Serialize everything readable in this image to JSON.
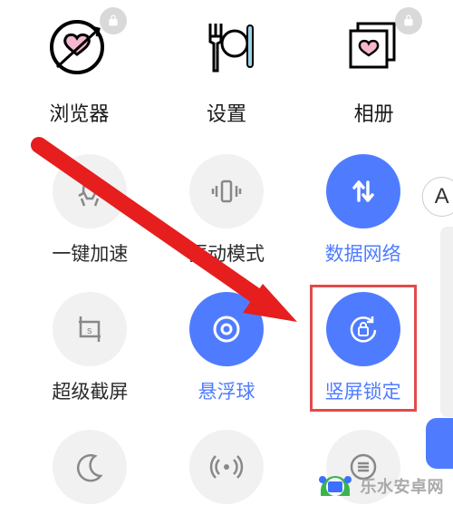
{
  "apps": [
    {
      "label": "浏览器",
      "icon": "heart-target-icon",
      "locked": true
    },
    {
      "label": "设置",
      "icon": "cutlery-icon",
      "locked": false
    },
    {
      "label": "相册",
      "icon": "gallery-heart-icon",
      "locked": true
    }
  ],
  "tiles": [
    {
      "label": "一键加速",
      "icon": "rocket-icon",
      "active": false
    },
    {
      "label": "振动模式",
      "icon": "vibrate-icon",
      "active": false
    },
    {
      "label": "数据网络",
      "icon": "data-arrows-icon",
      "active": true
    },
    {
      "label": "超级截屏",
      "icon": "crop-icon",
      "active": false
    },
    {
      "label": "悬浮球",
      "icon": "floating-ball-icon",
      "active": true
    },
    {
      "label": "竖屏锁定",
      "icon": "orientation-lock-icon",
      "active": true,
      "highlighted": true
    }
  ],
  "extra_row_icons": [
    {
      "icon": "moon-icon"
    },
    {
      "icon": "hotspot-icon"
    },
    {
      "icon": "menu-icon"
    }
  ],
  "edge": {
    "letter": "A"
  },
  "watermark": {
    "text": "乐水安卓网"
  },
  "colors": {
    "accent": "#4f7cff",
    "highlight": "#e24b4b",
    "inactive_bg": "#f1f1f1"
  }
}
